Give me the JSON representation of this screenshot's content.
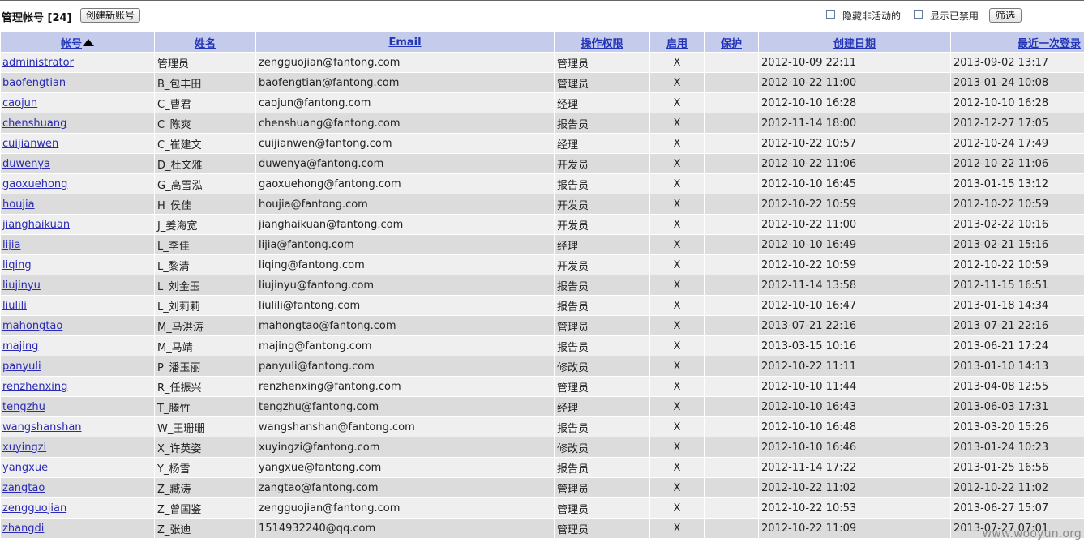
{
  "toolbar": {
    "title": "管理帐号 [24]",
    "create_button": "创建新账号",
    "hide_inactive_label": "隐藏非活动的",
    "show_disabled_label": "显示已禁用",
    "filter_button": "筛选"
  },
  "columns": {
    "account": "帐号",
    "name": "姓名",
    "email": "Email",
    "permission": "操作权限",
    "enabled": "启用",
    "protected": "保护",
    "created": "创建日期",
    "last_login": "最近一次登录"
  },
  "rows": [
    {
      "account": "administrator",
      "name": "管理员",
      "email": "zengguojian@fantong.com",
      "permission": "管理员",
      "enabled": "X",
      "protected": "",
      "created": "2012-10-09 22:11",
      "last_login": "2013-09-02 13:17"
    },
    {
      "account": "baofengtian",
      "name": "B_包丰田",
      "email": "baofengtian@fantong.com",
      "permission": "管理员",
      "enabled": "X",
      "protected": "",
      "created": "2012-10-22 11:00",
      "last_login": "2013-01-24 10:08"
    },
    {
      "account": "caojun",
      "name": "C_曹君",
      "email": "caojun@fantong.com",
      "permission": "经理",
      "enabled": "X",
      "protected": "",
      "created": "2012-10-10 16:28",
      "last_login": "2012-10-10 16:28"
    },
    {
      "account": "chenshuang",
      "name": "C_陈爽",
      "email": "chenshuang@fantong.com",
      "permission": "报告员",
      "enabled": "X",
      "protected": "",
      "created": "2012-11-14 18:00",
      "last_login": "2012-12-27 17:05"
    },
    {
      "account": "cuijianwen",
      "name": "C_崔建文",
      "email": "cuijianwen@fantong.com",
      "permission": "经理",
      "enabled": "X",
      "protected": "",
      "created": "2012-10-22 10:57",
      "last_login": "2012-10-24 17:49"
    },
    {
      "account": "duwenya",
      "name": "D_杜文雅",
      "email": "duwenya@fantong.com",
      "permission": "开发员",
      "enabled": "X",
      "protected": "",
      "created": "2012-10-22 11:06",
      "last_login": "2012-10-22 11:06"
    },
    {
      "account": "gaoxuehong",
      "name": "G_高雪泓",
      "email": "gaoxuehong@fantong.com",
      "permission": "报告员",
      "enabled": "X",
      "protected": "",
      "created": "2012-10-10 16:45",
      "last_login": "2013-01-15 13:12"
    },
    {
      "account": "houjia",
      "name": "H_侯佳",
      "email": "houjia@fantong.com",
      "permission": "开发员",
      "enabled": "X",
      "protected": "",
      "created": "2012-10-22 10:59",
      "last_login": "2012-10-22 10:59"
    },
    {
      "account": "jianghaikuan",
      "name": "J_姜海宽",
      "email": "jianghaikuan@fantong.com",
      "permission": "开发员",
      "enabled": "X",
      "protected": "",
      "created": "2012-10-22 11:00",
      "last_login": "2013-02-22 10:16"
    },
    {
      "account": "lijia",
      "name": "L_李佳",
      "email": "lijia@fantong.com",
      "permission": "经理",
      "enabled": "X",
      "protected": "",
      "created": "2012-10-10 16:49",
      "last_login": "2013-02-21 15:16"
    },
    {
      "account": "liqing",
      "name": "L_黎清",
      "email": "liqing@fantong.com",
      "permission": "开发员",
      "enabled": "X",
      "protected": "",
      "created": "2012-10-22 10:59",
      "last_login": "2012-10-22 10:59"
    },
    {
      "account": "liujinyu",
      "name": "L_刘金玉",
      "email": "liujinyu@fantong.com",
      "permission": "报告员",
      "enabled": "X",
      "protected": "",
      "created": "2012-11-14 13:58",
      "last_login": "2012-11-15 16:51"
    },
    {
      "account": "liulili",
      "name": "L_刘莉莉",
      "email": "liulili@fantong.com",
      "permission": "报告员",
      "enabled": "X",
      "protected": "",
      "created": "2012-10-10 16:47",
      "last_login": "2013-01-18 14:34"
    },
    {
      "account": "mahongtao",
      "name": "M_马洪涛",
      "email": "mahongtao@fantong.com",
      "permission": "管理员",
      "enabled": "X",
      "protected": "",
      "created": "2013-07-21 22:16",
      "last_login": "2013-07-21 22:16"
    },
    {
      "account": "majing",
      "name": "M_马靖",
      "email": "majing@fantong.com",
      "permission": "报告员",
      "enabled": "X",
      "protected": "",
      "created": "2013-03-15 10:16",
      "last_login": "2013-06-21 17:24"
    },
    {
      "account": "panyuli",
      "name": "P_潘玉丽",
      "email": "panyuli@fantong.com",
      "permission": "修改员",
      "enabled": "X",
      "protected": "",
      "created": "2012-10-22 11:11",
      "last_login": "2013-01-10 14:13"
    },
    {
      "account": "renzhenxing",
      "name": "R_任振兴",
      "email": "renzhenxing@fantong.com",
      "permission": "管理员",
      "enabled": "X",
      "protected": "",
      "created": "2012-10-10 11:44",
      "last_login": "2013-04-08 12:55"
    },
    {
      "account": "tengzhu",
      "name": "T_滕竹",
      "email": "tengzhu@fantong.com",
      "permission": "经理",
      "enabled": "X",
      "protected": "",
      "created": "2012-10-10 16:43",
      "last_login": "2013-06-03 17:31"
    },
    {
      "account": "wangshanshan",
      "name": "W_王珊珊",
      "email": "wangshanshan@fantong.com",
      "permission": "报告员",
      "enabled": "X",
      "protected": "",
      "created": "2012-10-10 16:48",
      "last_login": "2013-03-20 15:26"
    },
    {
      "account": "xuyingzi",
      "name": "X_许英姿",
      "email": "xuyingzi@fantong.com",
      "permission": "修改员",
      "enabled": "X",
      "protected": "",
      "created": "2012-10-10 16:46",
      "last_login": "2013-01-24 10:23"
    },
    {
      "account": "yangxue",
      "name": "Y_杨雪",
      "email": "yangxue@fantong.com",
      "permission": "报告员",
      "enabled": "X",
      "protected": "",
      "created": "2012-11-14 17:22",
      "last_login": "2013-01-25 16:56"
    },
    {
      "account": "zangtao",
      "name": "Z_臧涛",
      "email": "zangtao@fantong.com",
      "permission": "管理员",
      "enabled": "X",
      "protected": "",
      "created": "2012-10-22 11:02",
      "last_login": "2012-10-22 11:02"
    },
    {
      "account": "zengguojian",
      "name": "Z_曾国鉴",
      "email": "zengguojian@fantong.com",
      "permission": "管理员",
      "enabled": "X",
      "protected": "",
      "created": "2012-10-22 10:53",
      "last_login": "2013-06-27 15:07"
    },
    {
      "account": "zhangdi",
      "name": "Z_张迪",
      "email": "1514932240@qq.com",
      "permission": "管理员",
      "enabled": "X",
      "protected": "",
      "created": "2012-10-22 11:09",
      "last_login": "2013-07-27 07:01"
    }
  ],
  "watermark": "www.wooyun.org",
  "icons": {
    "sort": "sort-ascending-icon"
  },
  "colors": {
    "header_bg": "#c5cbeb",
    "row_odd": "#efefef",
    "row_even": "#dcdcdc",
    "link": "#2a2ab5"
  }
}
